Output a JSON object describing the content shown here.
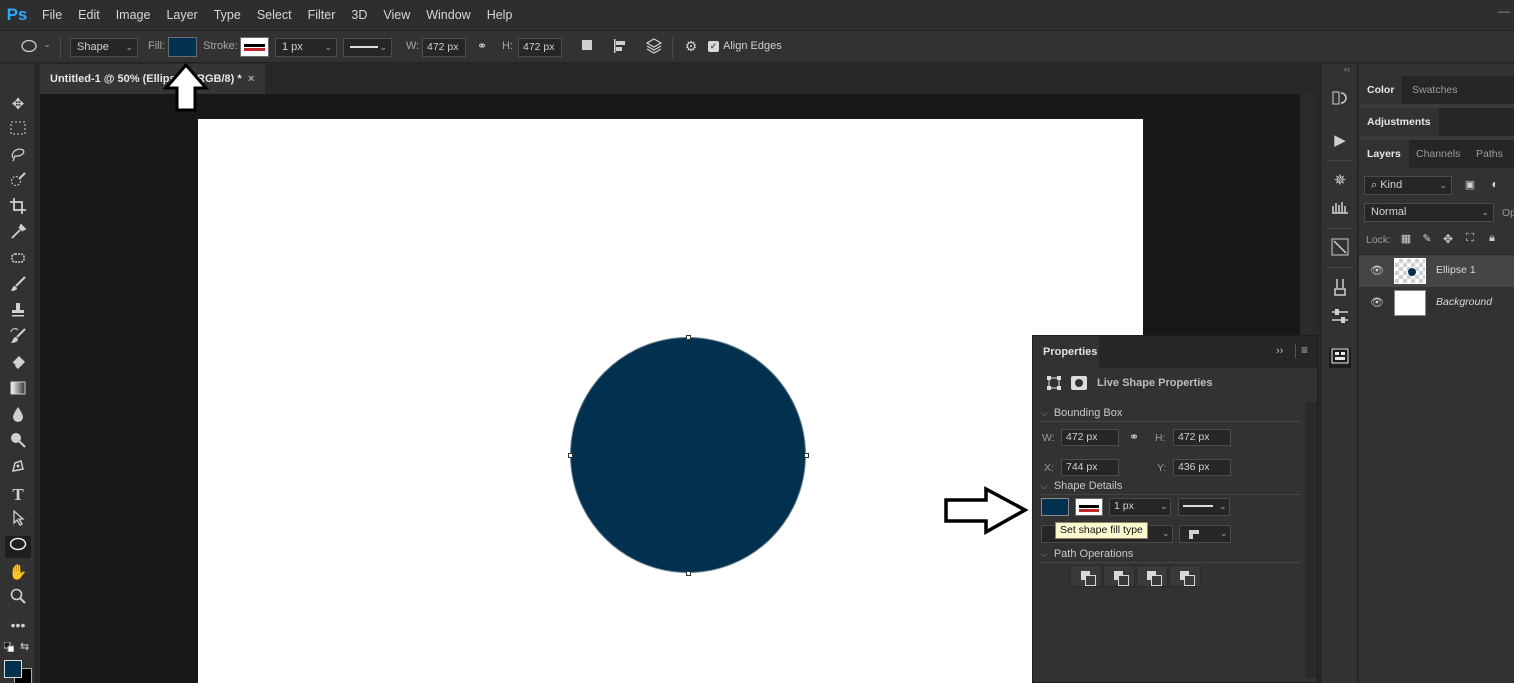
{
  "app": {
    "logo": "Ps"
  },
  "menu": [
    "File",
    "Edit",
    "Image",
    "Layer",
    "Type",
    "Select",
    "Filter",
    "3D",
    "View",
    "Window",
    "Help"
  ],
  "options_bar": {
    "mode": "Shape",
    "fill_label": "Fill:",
    "stroke_label": "Stroke:",
    "stroke_width": "1 px",
    "w_label": "W:",
    "w_value": "472 px",
    "h_label": "H:",
    "h_value": "472 px",
    "align_edges": "Align Edges",
    "fill_color": "#02304f"
  },
  "document_tab": {
    "title": "Untitled-1 @ 50% (Ellipse 1, RGB/8) *",
    "close": "×"
  },
  "tools": [
    "move-icon",
    "marquee-icon",
    "lasso-icon",
    "quick-select-icon",
    "crop-icon",
    "eyedropper-icon",
    "healing-icon",
    "brush-icon",
    "stamp-icon",
    "history-brush-icon",
    "eraser-icon",
    "gradient-icon",
    "blur-icon",
    "dodge-icon",
    "pen-icon",
    "type-icon",
    "path-select-icon",
    "ellipse-icon",
    "hand-icon",
    "zoom-icon",
    "more-icon"
  ],
  "properties": {
    "title": "Properties",
    "live_shape": "Live Shape Properties",
    "bounding_box": "Bounding Box",
    "w_label": "W:",
    "w_value": "472 px",
    "h_label": "H:",
    "h_value": "472 px",
    "x_label": "X:",
    "x_value": "744 px",
    "y_label": "Y:",
    "y_value": "436 px",
    "shape_details": "Shape Details",
    "stroke_width": "1 px",
    "tooltip": "Set shape fill type",
    "path_operations": "Path Operations"
  },
  "right_panels": {
    "tabs_top": [
      "Color",
      "Swatches"
    ],
    "adjustments": "Adjustments",
    "tabs_layers": [
      "Layers",
      "Channels",
      "Paths"
    ],
    "kind": "Kind",
    "blend_mode": "Normal",
    "opacity_cut": "Op",
    "lock_label": "Lock:",
    "layers": [
      {
        "name": "Ellipse 1",
        "selected": true
      },
      {
        "name": "Background",
        "selected": false
      }
    ]
  }
}
